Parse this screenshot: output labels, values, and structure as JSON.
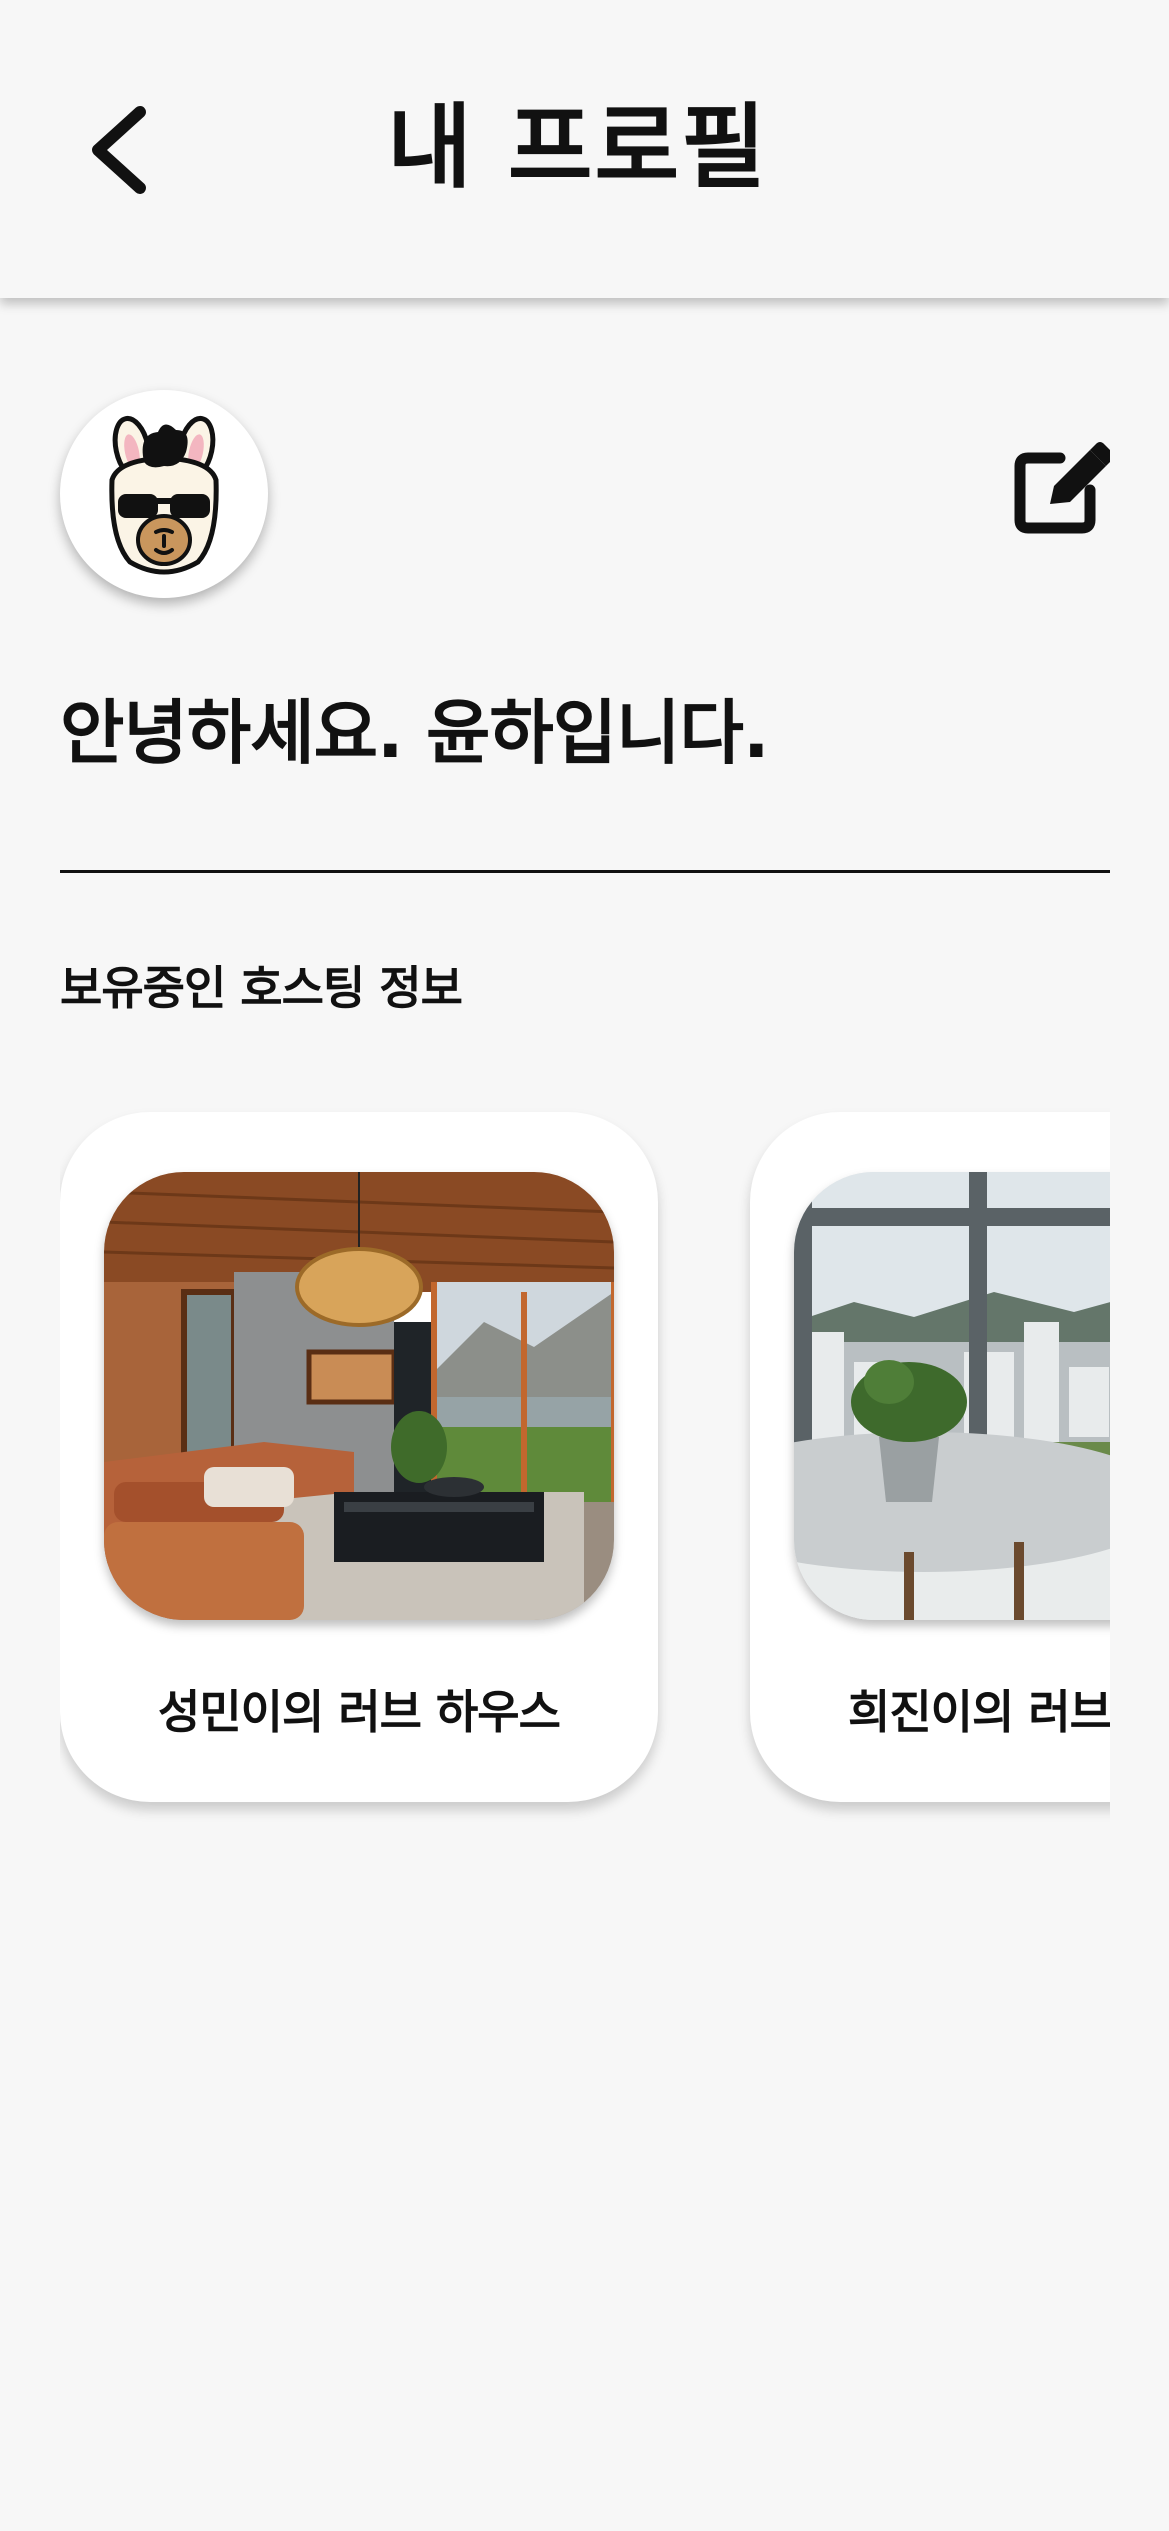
{
  "header": {
    "title": "내 프로필",
    "back_icon": "chevron-left-icon"
  },
  "profile": {
    "avatar": "llama-sunglasses-avatar",
    "edit_icon": "edit-icon",
    "greeting": "안녕하세요. 윤하입니다."
  },
  "hosting": {
    "section_title": "보유중인 호스팅 정보",
    "cards": [
      {
        "label": "성민이의 러브 하우스",
        "image": "living-room-photo"
      },
      {
        "label": "희진이의 러브 하우스",
        "image": "window-view-photo"
      }
    ]
  },
  "colors": {
    "background": "#f7f7f7",
    "card": "#ffffff",
    "text": "#111111"
  }
}
